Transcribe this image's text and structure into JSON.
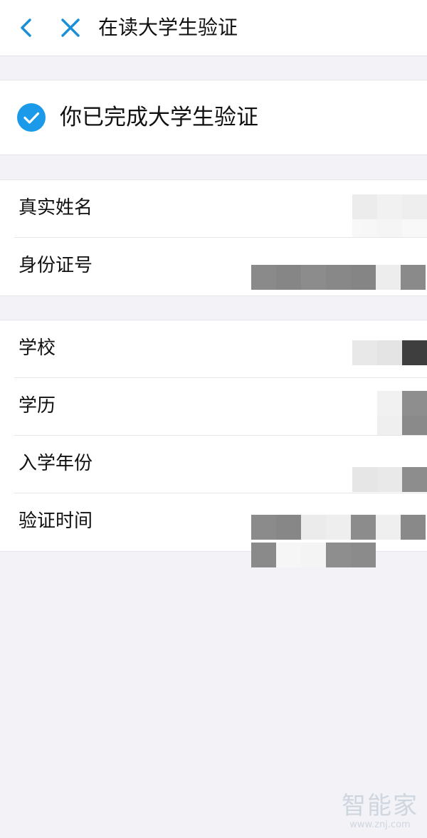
{
  "nav": {
    "title": "在读大学生验证",
    "back_icon": "chevron-left-icon",
    "close_icon": "close-icon",
    "icon_color": "#1a8fd8"
  },
  "status": {
    "text": "你已完成大学生验证",
    "icon": "check-circle-icon",
    "icon_color": "#1a9ae8"
  },
  "identity": {
    "rows": [
      {
        "label": "真实姓名"
      },
      {
        "label": "身份证号"
      }
    ]
  },
  "education": {
    "rows": [
      {
        "label": "学校"
      },
      {
        "label": "学历"
      },
      {
        "label": "入学年份"
      },
      {
        "label": "验证时间"
      }
    ]
  },
  "watermark": {
    "logo": "智能家",
    "url": "www.znj.com"
  }
}
